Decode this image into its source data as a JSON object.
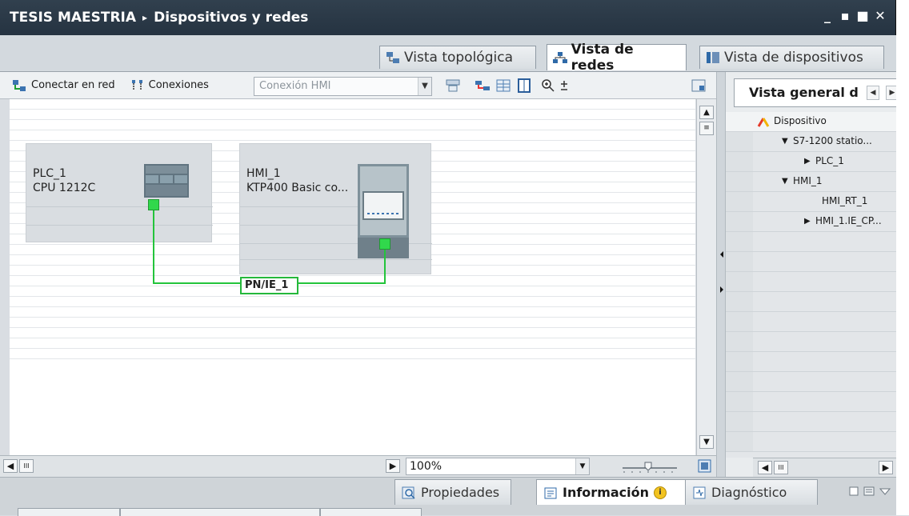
{
  "titlebar": {
    "project": "TESIS MAESTRIA",
    "separator": "▸",
    "page": "Dispositivos y redes",
    "buttons": [
      "_",
      "▪",
      "■",
      "✕"
    ]
  },
  "view_tabs": [
    {
      "label": "Vista topológica",
      "active": false
    },
    {
      "label": "Vista de redes",
      "active": true
    },
    {
      "label": "Vista de dispositivos",
      "active": false
    }
  ],
  "toolbar": {
    "connect_label": "Conectar en red",
    "connections_label": "Conexiones",
    "connection_type": "Conexión HMI"
  },
  "devices": [
    {
      "name": "PLC_1",
      "type": "CPU 1212C"
    },
    {
      "name": "HMI_1",
      "type": "KTP400 Basic co..."
    }
  ],
  "network": {
    "label": "PN/IE_1",
    "color": "#23c43b"
  },
  "canvas_status": {
    "zoom": "100%"
  },
  "overview": {
    "tab_label": "Vista general d",
    "header": "Dispositivo",
    "rows": [
      {
        "expander": "▼",
        "label": "S7-1200 statio..."
      },
      {
        "expander": "▶",
        "label": "PLC_1"
      },
      {
        "expander": "▼",
        "label": "HMI_1"
      },
      {
        "expander": "",
        "label": "HMI_RT_1"
      },
      {
        "expander": "▶",
        "label": "HMI_1.IE_CP..."
      }
    ]
  },
  "inspector_tabs": [
    {
      "label": "Propiedades",
      "active": false
    },
    {
      "label": "Información",
      "active": true
    },
    {
      "label": "Diagnóstico",
      "active": false
    }
  ]
}
